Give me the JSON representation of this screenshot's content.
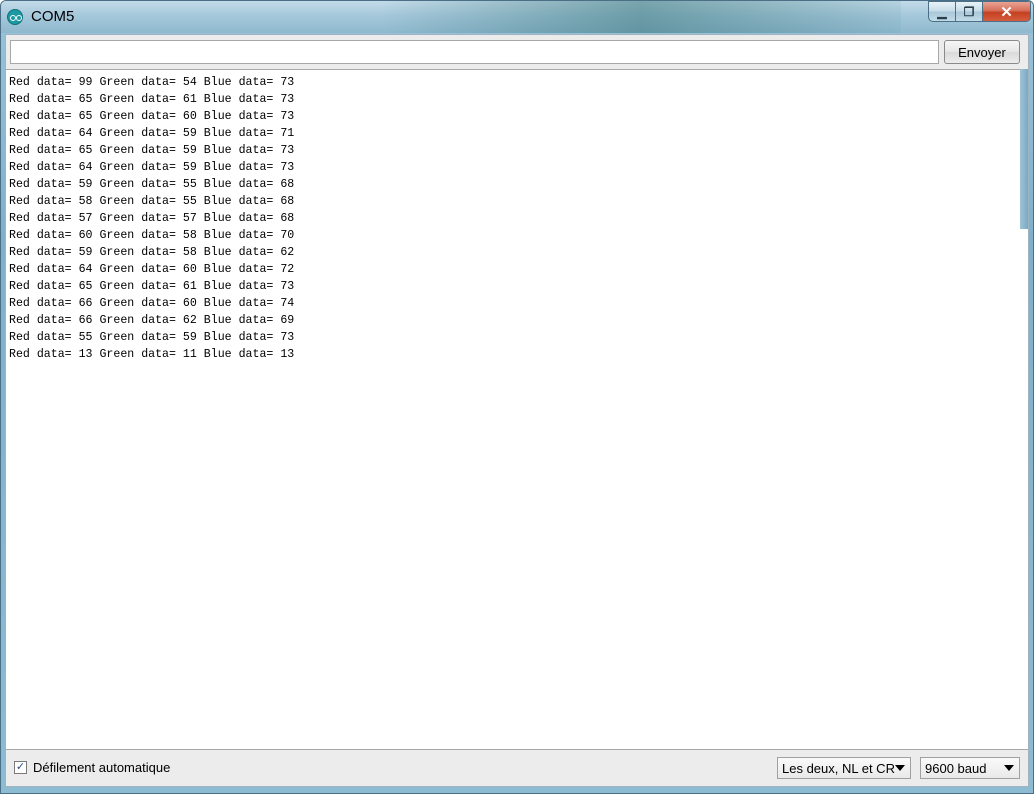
{
  "window": {
    "title": "COM5",
    "minimize_glyph": "▁",
    "maximize_glyph": "❐",
    "close_glyph": "✕"
  },
  "input": {
    "value": "",
    "send_label": "Envoyer"
  },
  "output_lines": [
    "Red data= 99 Green data= 54 Blue data= 73",
    "Red data= 65 Green data= 61 Blue data= 73",
    "Red data= 65 Green data= 60 Blue data= 73",
    "Red data= 64 Green data= 59 Blue data= 71",
    "Red data= 65 Green data= 59 Blue data= 73",
    "Red data= 64 Green data= 59 Blue data= 73",
    "Red data= 59 Green data= 55 Blue data= 68",
    "Red data= 58 Green data= 55 Blue data= 68",
    "Red data= 57 Green data= 57 Blue data= 68",
    "Red data= 60 Green data= 58 Blue data= 70",
    "Red data= 59 Green data= 58 Blue data= 62",
    "Red data= 64 Green data= 60 Blue data= 72",
    "Red data= 65 Green data= 61 Blue data= 73",
    "Red data= 66 Green data= 60 Blue data= 74",
    "Red data= 66 Green data= 62 Blue data= 69",
    "Red data= 55 Green data= 59 Blue data= 73",
    "Red data= 13 Green data= 11 Blue data= 13"
  ],
  "footer": {
    "autoscroll_label": "Défilement automatique",
    "autoscroll_checked": true,
    "check_glyph": "✓",
    "line_ending": "Les deux, NL et CR",
    "baud_rate": "9600 baud"
  },
  "icons": {
    "app": "arduino-icon",
    "checkbox": "checkmark-icon",
    "dropdown": "chevron-down-icon"
  }
}
